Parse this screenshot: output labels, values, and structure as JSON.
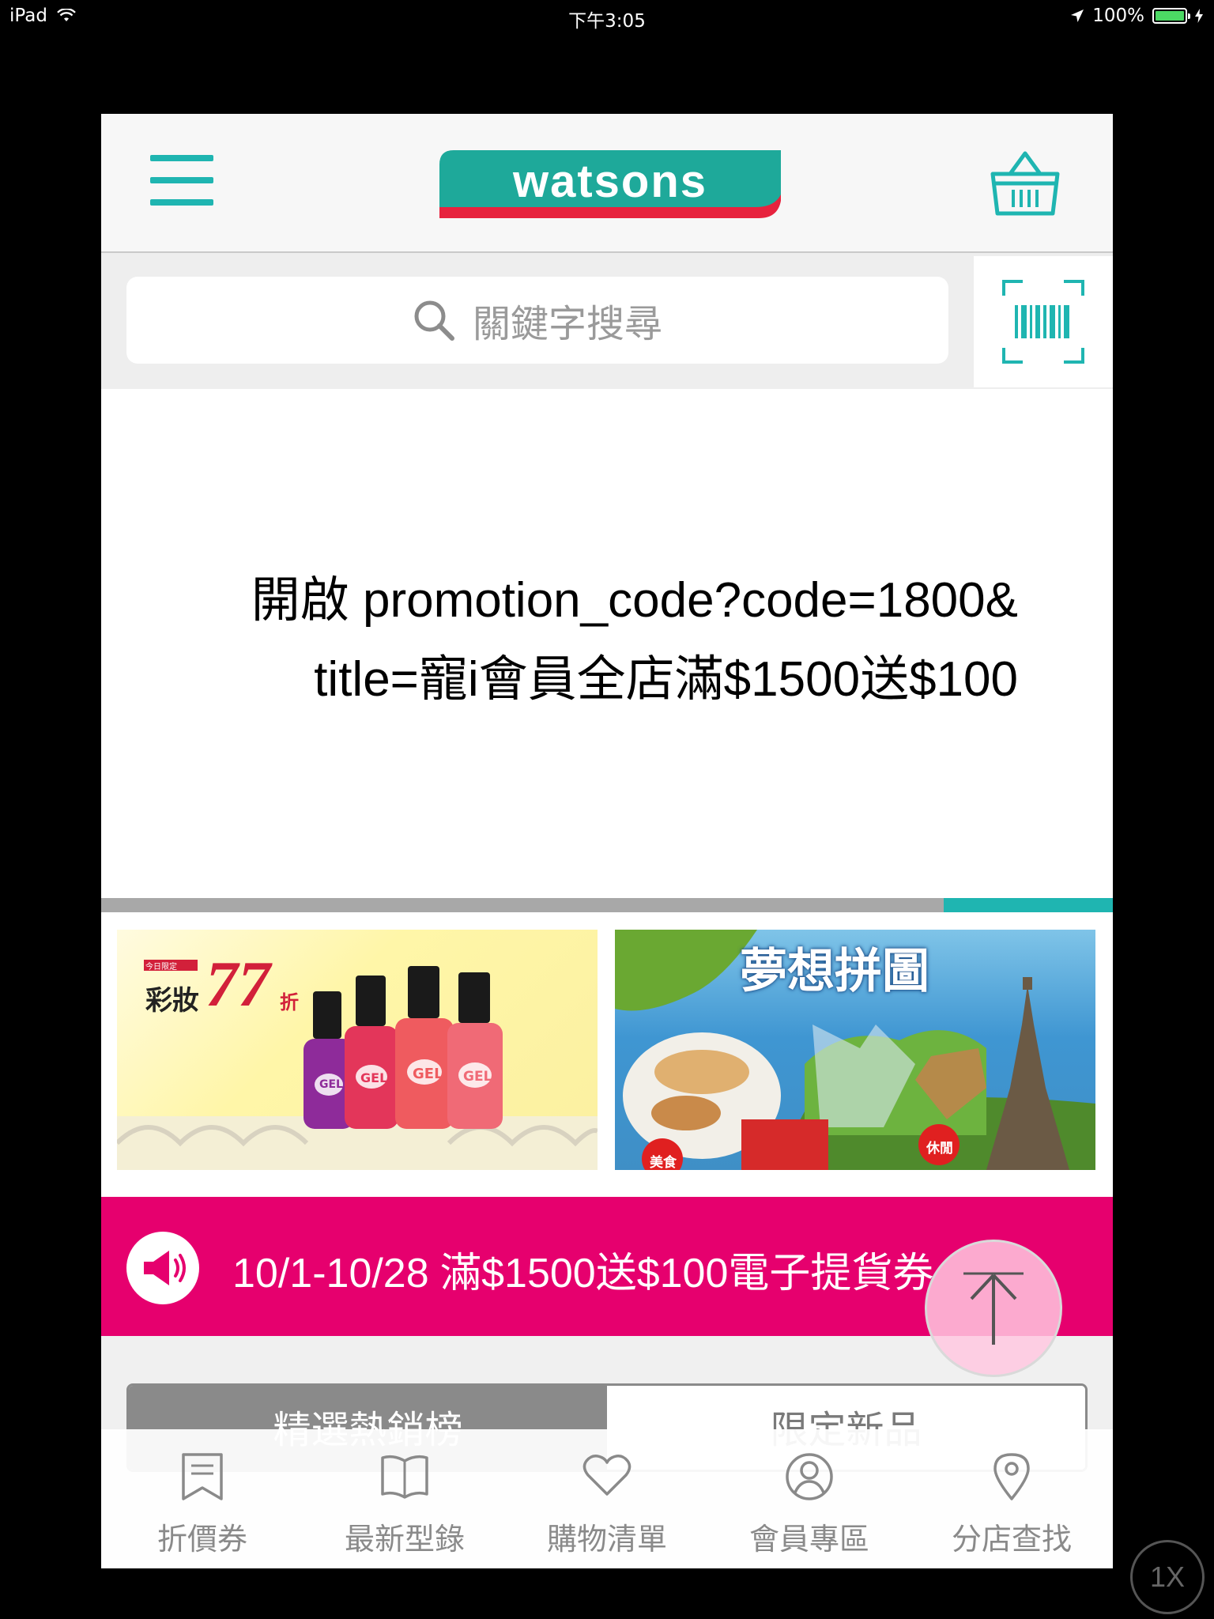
{
  "status_bar": {
    "device": "iPad",
    "time": "下午3:05",
    "battery": "100%"
  },
  "header": {
    "logo_text": "watsons",
    "menu_icon": "hamburger-icon",
    "cart_icon": "basket-icon"
  },
  "search": {
    "placeholder": "關鍵字搜尋",
    "scan_icon": "barcode-scan-icon"
  },
  "promo": {
    "line1": "開啟 promotion_code?code=1800&",
    "line2": "title=寵i會員全店滿$1500送$100"
  },
  "banners": {
    "left": {
      "badge": "今日限定",
      "title": "彩妝",
      "discount": "77",
      "unit": "折",
      "product_label": "GEL"
    },
    "right": {
      "title": "夢想拼圖",
      "tag1": "美食",
      "tag2": "休閒"
    }
  },
  "announcement": {
    "text": "10/1-10/28 滿$1500送$100電子提貨券",
    "icon": "megaphone-icon"
  },
  "segment_tabs": [
    {
      "label": "精選熱銷榜",
      "active": true
    },
    {
      "label": "限定新品",
      "active": false
    }
  ],
  "tab_bar": [
    {
      "label": "折價券",
      "icon": "coupon-icon"
    },
    {
      "label": "最新型錄",
      "icon": "catalog-icon"
    },
    {
      "label": "購物清單",
      "icon": "heart-icon"
    },
    {
      "label": "會員專區",
      "icon": "member-icon"
    },
    {
      "label": "分店查找",
      "icon": "location-pin-icon"
    }
  ],
  "zoom_button": "1X",
  "colors": {
    "brand_teal": "#1fb5b1",
    "brand_red": "#e7233e",
    "announcement_pink": "#e6006e"
  }
}
